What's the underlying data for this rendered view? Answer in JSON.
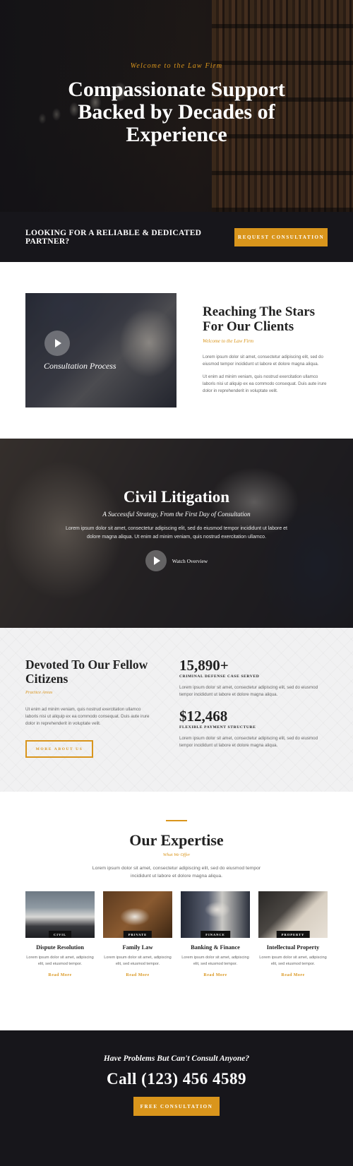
{
  "hero": {
    "kicker": "Welcome to the Law Firm",
    "title": "Compassionate Support Backed by Decades of Experience"
  },
  "partner": {
    "text": "LOOKING FOR A RELIABLE & DEDICATED PARTNER?",
    "button": "REQUEST CONSULTATION"
  },
  "reach": {
    "video_caption": "Consultation Process",
    "title": "Reaching The Stars For Our Clients",
    "subtitle": "Welcome to the Law Firm",
    "p1": "Lorem ipsum dolor sit amet, consectetur adipiscing elit, sed do eiusmod tempor incididunt ut labore et dolore magna aliqua.",
    "p2": "Ut enim ad minim veniam, quis nostrud exercitation ullamco laboris nisi ut aliquip ex ea commodo consequat. Duis aute irure dolor in reprehenderit in voluptate velit."
  },
  "civil": {
    "title": "Civil Litigation",
    "subtitle": "A Successful Strategy, From the First Day of Consultation",
    "desc": "Lorem ipsum dolor sit amet, consectetur adipiscing elit, sed do eiusmod tempor incididunt ut labore et dolore magna aliqua. Ut enim ad minim veniam, quis nostrud exercitation ullamco.",
    "watch": "Watch Overview"
  },
  "devoted": {
    "title": "Devoted To Our Fellow Citizens",
    "subtitle": "Practice Areas",
    "desc": "Ut enim ad minim veniam, quis nostrud exercitation ullamco laboris nisi ut aliquip ex ea commodo consequat. Duis aute irure dolor in reprehenderit in voluptate velit.",
    "button": "MORE ABOUT US",
    "stats": [
      {
        "num": "15,890+",
        "label": "CRIMINAL DEFENSE CASE SERVED",
        "desc": "Lorem ipsum dolor sit amet, consectetur adipiscing elit, sed do eiusmod tempor incididunt ut labore et dolore magna aliqua."
      },
      {
        "num": "$12,468",
        "label": "FLEXIBLE PAYMENT STRUCTURE",
        "desc": "Lorem ipsum dolor sit amet, consectetur adipiscing elit, sed do eiusmod tempor incididunt ut labore et dolore magna aliqua."
      }
    ]
  },
  "expertise": {
    "title": "Our Expertise",
    "subtitle": "What We Offer",
    "desc": "Lorem ipsum dolor sit amet, consectetur adipiscing elit, sed do eiusmod tempor incididunt ut labore et dolore magna aliqua.",
    "cards": [
      {
        "badge": "CIVIL",
        "title": "Dispute Resolution",
        "desc": "Lorem ipsum dolor sit amet, adipiscing elit, sed eiusmod tempor.",
        "more": "Read More"
      },
      {
        "badge": "PRIVATE",
        "title": "Family Law",
        "desc": "Lorem ipsum dolor sit amet, adipiscing elit, sed eiusmod tempor.",
        "more": "Read More"
      },
      {
        "badge": "FINANCE",
        "title": "Banking & Finance",
        "desc": "Lorem ipsum dolor sit amet, adipiscing elit, sed eiusmod tempor.",
        "more": "Read More"
      },
      {
        "badge": "PROPERTY",
        "title": "Intellectual Property",
        "desc": "Lorem ipsum dolor sit amet, adipiscing elit, sed eiusmod tempor.",
        "more": "Read More"
      }
    ]
  },
  "contact": {
    "question": "Have Problems But Can't Consult Anyone?",
    "phone": "Call (123) 456 4589",
    "button": "FREE CONSULTATION"
  },
  "colors": {
    "accent": "#d9951c",
    "dark": "#17161b"
  }
}
